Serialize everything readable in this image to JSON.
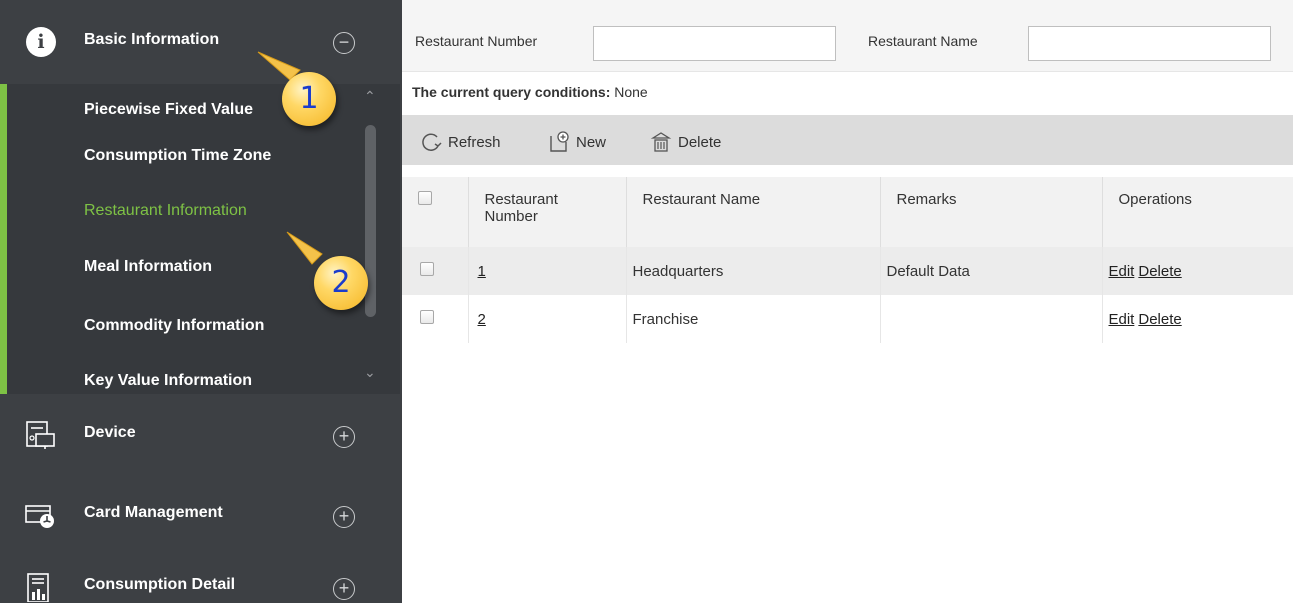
{
  "sidebar": {
    "header": {
      "label": "Basic Information",
      "toggle": "−"
    },
    "submenu": [
      {
        "label": "Piecewise Fixed Value"
      },
      {
        "label": "Consumption Time Zone"
      },
      {
        "label": "Restaurant Information",
        "active": true
      },
      {
        "label": "Meal Information"
      },
      {
        "label": "Commodity Information"
      },
      {
        "label": "Key Value Information"
      }
    ],
    "modules": [
      {
        "label": "Device",
        "icon": "device-icon",
        "toggle": "+"
      },
      {
        "label": "Card Management",
        "icon": "card-management-icon",
        "toggle": "+"
      },
      {
        "label": "Consumption Detail",
        "icon": "consumption-detail-icon",
        "toggle": "+"
      }
    ]
  },
  "badges": {
    "one": "1",
    "two": "2"
  },
  "filters": {
    "restaurant_number_label": "Restaurant Number",
    "restaurant_number_value": "",
    "restaurant_name_label": "Restaurant Name",
    "restaurant_name_value": ""
  },
  "query": {
    "label": "The current query conditions:",
    "value": "None"
  },
  "toolbar": {
    "refresh": "Refresh",
    "new": "New",
    "delete": "Delete"
  },
  "table": {
    "headers": {
      "number_line1": "Restaurant",
      "number_line2": "Number",
      "name": "Restaurant Name",
      "remarks": "Remarks",
      "operations": "Operations"
    },
    "rows": [
      {
        "number": "1",
        "name": "Headquarters",
        "remarks": "Default Data",
        "edit": "Edit",
        "delete": "Delete"
      },
      {
        "number": "2",
        "name": "Franchise",
        "remarks": "",
        "edit": "Edit",
        "delete": "Delete"
      }
    ]
  },
  "colors": {
    "sidebar_bg": "#3d4044",
    "accent": "#7ec245",
    "toolbar_bg": "#dcdcdc",
    "badge_text": "#1a3ccc"
  }
}
